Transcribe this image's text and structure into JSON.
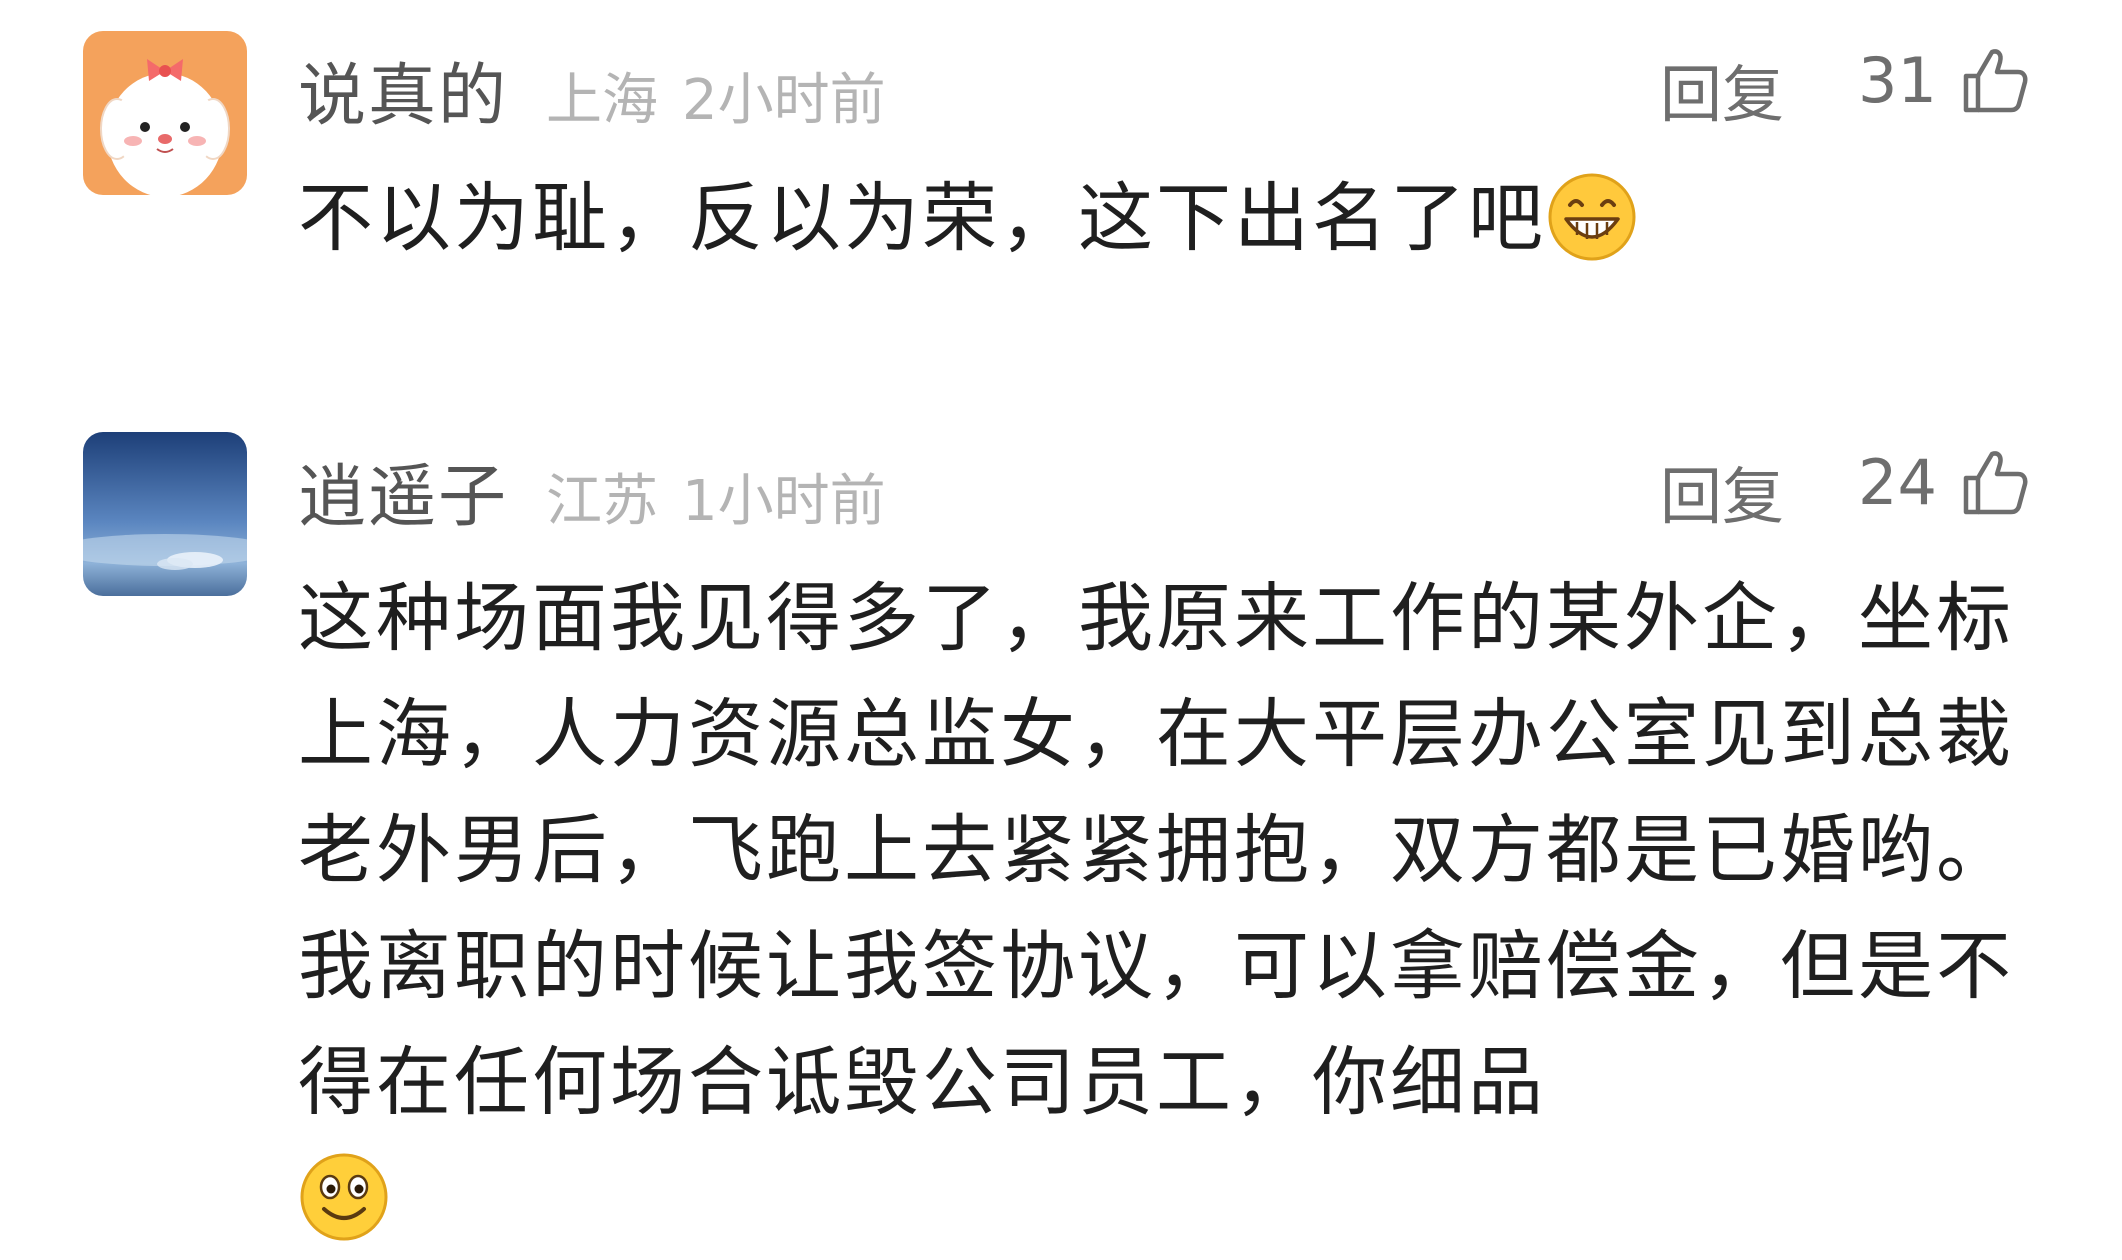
{
  "comments": [
    {
      "username": "说真的",
      "location": "上海",
      "time": "2小时前",
      "reply_label": "回复",
      "likes": "31",
      "text": "不以为耻，反以为荣，这下出名了吧",
      "avatar_icon": "cartoon-dog-avatar-icon",
      "trailing_emoji": "grinning-face-emoji"
    },
    {
      "username": "逍遥子",
      "location": "江苏",
      "time": "1小时前",
      "reply_label": "回复",
      "likes": "24",
      "text": "这种场面我见得多了，我原来工作的某外企，坐标上海，人力资源总监女，在大平层办公室见到总裁老外男后，飞跑上去紧紧拥抱，双方都是已婚哟。我离职的时候让我签协议，可以拿赔偿金，但是不得在任何场合诋毁公司员工，你细品",
      "avatar_icon": "sky-landscape-avatar-icon",
      "trailing_emoji": "smiling-face-emoji"
    }
  ],
  "colors": {
    "username": "#555555",
    "meta": "#b4b4b4",
    "action": "#6e6e6e",
    "body_text": "#1f1f1f"
  }
}
